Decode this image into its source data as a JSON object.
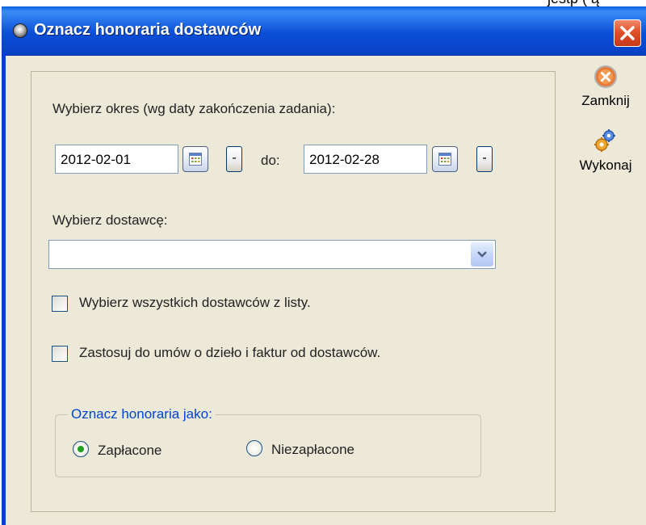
{
  "window": {
    "title": "Oznacz honoraria dostawców",
    "clipped_text_above": "jestp ( ą"
  },
  "period": {
    "label": "Wybierz okres (wg daty zakończenia zadania):",
    "from_value": "2012-02-01",
    "to_label": "do:",
    "to_value": "2012-02-28",
    "clear_button_label": "-"
  },
  "supplier": {
    "label": "Wybierz dostawcę:",
    "selected_value": ""
  },
  "options": {
    "select_all_label": "Wybierz wszystkich dostawców z listy.",
    "select_all_checked": false,
    "apply_contracts_label": "Zastosuj do umów o dzieło i faktur od dostawców.",
    "apply_contracts_checked": false
  },
  "mark_as": {
    "legend": "Oznacz honoraria jako:",
    "paid_label": "Zapłacone",
    "unpaid_label": "Niezapłacone",
    "selected": "paid"
  },
  "actions": {
    "close_label": "Zamknij",
    "execute_label": "Wykonaj"
  },
  "colors": {
    "titlebar": "#0a4fd8",
    "dialog_bg": "#ece9d8",
    "legend_text": "#0046d5",
    "close_button": "#e0502a"
  }
}
